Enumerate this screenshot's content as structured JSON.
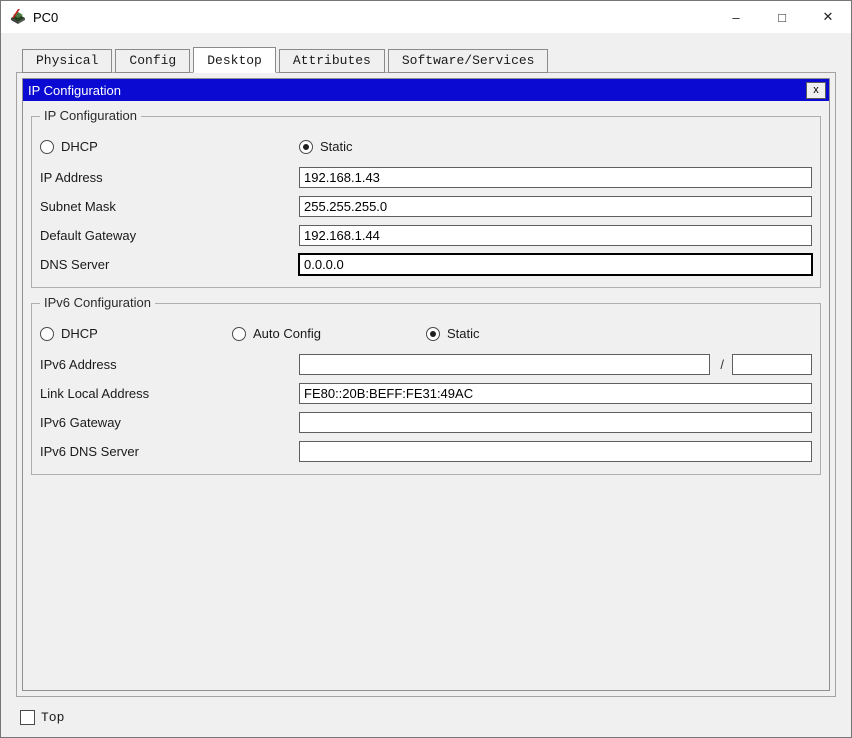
{
  "window": {
    "title": "PC0",
    "controls": {
      "minimize": "–",
      "maximize": "□",
      "close": "✕"
    }
  },
  "tabs": [
    {
      "label": "Physical",
      "active": false
    },
    {
      "label": "Config",
      "active": false
    },
    {
      "label": "Desktop",
      "active": true
    },
    {
      "label": "Attributes",
      "active": false
    },
    {
      "label": "Software/Services",
      "active": false
    }
  ],
  "dialog": {
    "title": "IP Configuration",
    "close_label": "x"
  },
  "ipv4": {
    "legend": "IP Configuration",
    "radios": [
      {
        "label": "DHCP",
        "selected": false
      },
      {
        "label": "Static",
        "selected": true
      }
    ],
    "fields": [
      {
        "label": "IP Address",
        "value": "192.168.1.43",
        "focused": false
      },
      {
        "label": "Subnet Mask",
        "value": "255.255.255.0",
        "focused": false
      },
      {
        "label": "Default Gateway",
        "value": "192.168.1.44",
        "focused": false
      },
      {
        "label": "DNS Server",
        "value": "0.0.0.0",
        "focused": true
      }
    ]
  },
  "ipv6": {
    "legend": "IPv6 Configuration",
    "radios": [
      {
        "label": "DHCP",
        "selected": false
      },
      {
        "label": "Auto Config",
        "selected": false
      },
      {
        "label": "Static",
        "selected": true
      }
    ],
    "prefix_separator": "/",
    "fields": [
      {
        "label": "IPv6 Address",
        "value": "",
        "prefix_value": ""
      },
      {
        "label": "Link Local Address",
        "value": "FE80::20B:BEFF:FE31:49AC"
      },
      {
        "label": "IPv6 Gateway",
        "value": ""
      },
      {
        "label": "IPv6 DNS Server",
        "value": ""
      }
    ]
  },
  "footer": {
    "top_label": "Top",
    "checked": false
  },
  "colors": {
    "dialog_header": "#0a0ad2",
    "panel_background": "#f0f0f0",
    "field_background": "#ffffff"
  }
}
